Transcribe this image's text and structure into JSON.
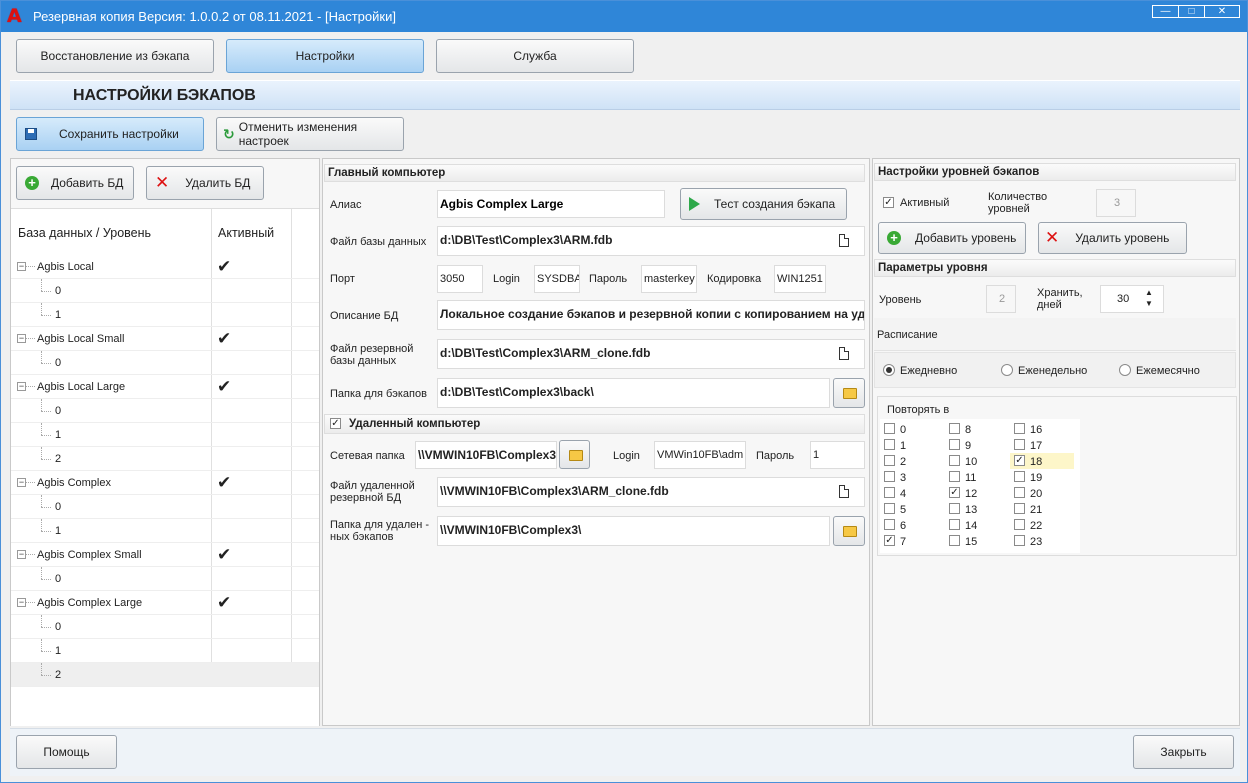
{
  "window": {
    "title": "Резервная копия   Версия: 1.0.0.2 от 08.11.2021 - [Настройки]",
    "controls": {
      "minimize": "—",
      "maximize": "□",
      "close": "✕"
    }
  },
  "tabs": [
    {
      "label": "Восстановление из бэкапа",
      "active": false
    },
    {
      "label": "Настройки",
      "active": true
    },
    {
      "label": "Служба",
      "active": false
    }
  ],
  "section_title": "НАСТРОЙКИ БЭКАПОВ",
  "toolbar": {
    "save_label": "Сохранить настройки",
    "cancel_label": "Отменить изменения настроек"
  },
  "db_panel": {
    "add_label": "Добавить БД",
    "delete_label": "Удалить БД",
    "col_name": "База данных / Уровень",
    "col_active": "Активный",
    "rows": [
      {
        "label": "Agbis Local",
        "level": 0,
        "active": true
      },
      {
        "label": "0",
        "level": 1,
        "active": false
      },
      {
        "label": "1",
        "level": 1,
        "active": false
      },
      {
        "label": "Agbis Local Small",
        "level": 0,
        "active": true
      },
      {
        "label": "0",
        "level": 1,
        "active": false
      },
      {
        "label": "Agbis Local Large",
        "level": 0,
        "active": true
      },
      {
        "label": "0",
        "level": 1,
        "active": false
      },
      {
        "label": "1",
        "level": 1,
        "active": false
      },
      {
        "label": "2",
        "level": 1,
        "active": false
      },
      {
        "label": "Agbis Complex",
        "level": 0,
        "active": true
      },
      {
        "label": "0",
        "level": 1,
        "active": false
      },
      {
        "label": "1",
        "level": 1,
        "active": false
      },
      {
        "label": "Agbis Complex Small",
        "level": 0,
        "active": true
      },
      {
        "label": "0",
        "level": 1,
        "active": false
      },
      {
        "label": "Agbis Complex Large",
        "level": 0,
        "active": true
      },
      {
        "label": "0",
        "level": 1,
        "active": false
      },
      {
        "label": "1",
        "level": 1,
        "active": false
      },
      {
        "label": "2",
        "level": 1,
        "active": false
      }
    ]
  },
  "main_computer": {
    "header": "Главный компьютер",
    "alias_label": "Алиас",
    "alias_value": "Agbis Complex Large",
    "test_label": "Тест создания бэкапа",
    "dbfile_label": "Файл базы данных",
    "dbfile_value": "d:\\DB\\Test\\Complex3\\ARM.fdb",
    "port_label": "Порт",
    "port_value": "3050",
    "login_label": "Login",
    "login_value": "SYSDBA",
    "password_label": "Пароль",
    "password_value": "masterkey",
    "encoding_label": "Кодировка",
    "encoding_value": "WIN1251",
    "desc_label": "Описание БД",
    "desc_value": "Локальное создание бэкапов и резервной копии с копированием на удаленный компьютер",
    "backup_file_label": "Файл резервной базы данных",
    "backup_file_value": "d:\\DB\\Test\\Complex3\\ARM_clone.fdb",
    "backup_folder_label": "Папка для бэкапов",
    "backup_folder_value": "d:\\DB\\Test\\Complex3\\back\\"
  },
  "remote_computer": {
    "header": "Удаленный компьютер",
    "enabled": true,
    "netfolder_label": "Сетевая папка",
    "netfolder_value": "\\\\VMWIN10FB\\Complex3\\",
    "login_label": "Login",
    "login_value": "VMWin10FB\\adm",
    "password_label": "Пароль",
    "password_value": "1",
    "remote_file_label": "Файл удаленной резервной БД",
    "remote_file_value": "\\\\VMWIN10FB\\Complex3\\ARM_clone.fdb",
    "remote_folder_label": "Папка для удален - ных бэкапов",
    "remote_folder_value": "\\\\VMWIN10FB\\Complex3\\"
  },
  "levels": {
    "header": "Настройки уровней бэкапов",
    "active_label": "Активный",
    "active_checked": true,
    "count_label": "Количество уровней",
    "count_value": "3",
    "add_label": "Добавить уровень",
    "delete_label": "Удалить уровень"
  },
  "level_params": {
    "header": "Параметры уровня",
    "level_label": "Уровень",
    "level_value": "2",
    "keep_label": "Хранить, дней",
    "keep_value": "30",
    "schedule_label": "Расписание",
    "schedule_options": [
      "Ежедневно",
      "Еженедельно",
      "Ежемесячно"
    ],
    "schedule_selected": "Ежедневно",
    "repeat_label": "Повторять в",
    "hours": [
      "0",
      "1",
      "2",
      "3",
      "4",
      "5",
      "6",
      "7",
      "8",
      "9",
      "10",
      "11",
      "12",
      "13",
      "14",
      "15",
      "16",
      "17",
      "18",
      "19",
      "20",
      "21",
      "22",
      "23"
    ],
    "hours_checked": [
      "7",
      "12",
      "18"
    ],
    "hour_highlight": "18"
  },
  "footer": {
    "help_label": "Помощь",
    "close_label": "Закрыть"
  }
}
